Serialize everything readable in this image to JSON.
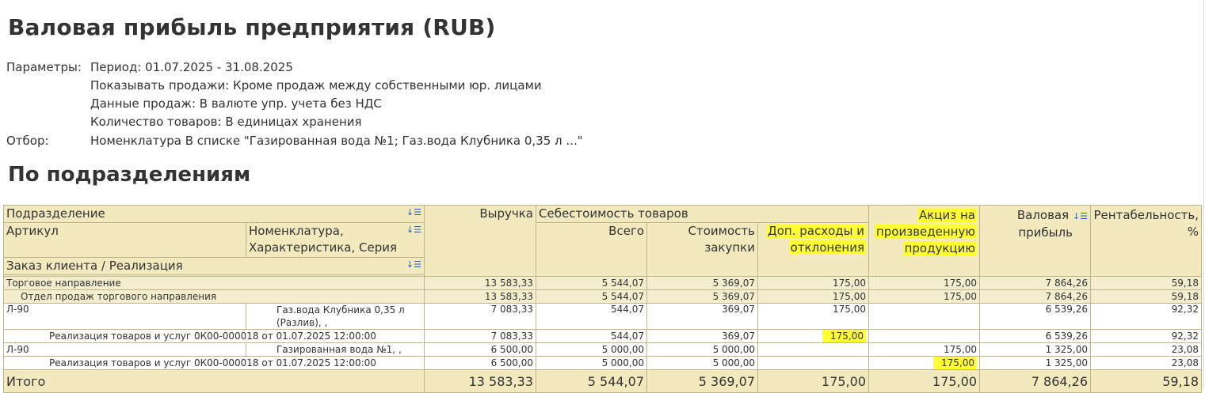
{
  "report": {
    "title": "Валовая прибыль предприятия (RUB)",
    "parameters_label": "Параметры:",
    "filter_label": "Отбор:",
    "parameters": [
      "Период: 01.07.2025 - 31.08.2025",
      "Показывать продажи: Кроме продаж между собственными юр. лицами",
      "Данные продаж: В валюте упр. учета без НДС",
      "Количество товаров: В единицах хранения"
    ],
    "filter": "Номенклатура В списке \"Газированная вода №1; Газ.вода Клубника 0,35 л ...\"",
    "section_title": "По подразделениям"
  },
  "table": {
    "headers": {
      "division": "Подразделение",
      "article": "Артикул",
      "nomenclature_line1": "Номенклатура,",
      "nomenclature_line2": "Характеристика, Серия",
      "order": "Заказ клиента / Реализация",
      "revenue": "Выручка",
      "cost_group": "Себестоимость товаров",
      "total": "Всего",
      "purchase_line1": "Стоимость",
      "purchase_line2": "закупки",
      "extra_line1": "Доп. расходы и",
      "extra_line2": "отклонения",
      "excise_line1": "Акциз на",
      "excise_line2": "произведенную",
      "excise_line3": "продукцию",
      "gross_line1": "Валовая",
      "gross_line2": "прибыль",
      "profit_line1": "Рентабельность,",
      "profit_line2": "%"
    },
    "rows": [
      {
        "label": "Торговое направление",
        "revenue": "13 583,33",
        "total": "5 544,07",
        "purchase": "5 369,07",
        "extra": "175,00",
        "excise": "175,00",
        "gross": "7 864,26",
        "profit": "59,18"
      },
      {
        "label": "Отдел продаж торгового направления",
        "revenue": "13 583,33",
        "total": "5 544,07",
        "purchase": "5 369,07",
        "extra": "175,00",
        "excise": "175,00",
        "gross": "7 864,26",
        "profit": "59,18"
      },
      {
        "article": "Л-90",
        "nom_line1": "Газ.вода Клубника 0,35 л",
        "nom_line2": "(Разлив), ,",
        "revenue": "7 083,33",
        "total": "544,07",
        "purchase": "369,07",
        "extra": "175,00",
        "excise": "",
        "gross": "6 539,26",
        "profit": "92,32"
      },
      {
        "label": "Реализация товаров и услуг 0К00-000018 от 01.07.2025 12:00:00",
        "revenue": "7 083,33",
        "total": "544,07",
        "purchase": "369,07",
        "extra": "175,00",
        "excise": "",
        "gross": "6 539,26",
        "profit": "92,32"
      },
      {
        "article": "Л-90",
        "nom_line1": "Газированная вода №1, ,",
        "revenue": "6 500,00",
        "total": "5 000,00",
        "purchase": "5 000,00",
        "extra": "",
        "excise": "175,00",
        "gross": "1 325,00",
        "profit": "23,08"
      },
      {
        "label": "Реализация товаров и услуг 0К00-000018 от 01.07.2025 12:00:00",
        "revenue": "6 500,00",
        "total": "5 000,00",
        "purchase": "5 000,00",
        "extra": "",
        "excise": "175,00",
        "gross": "1 325,00",
        "profit": "23,08"
      }
    ],
    "totals": {
      "label": "Итого",
      "revenue": "13 583,33",
      "total": "5 544,07",
      "purchase": "5 369,07",
      "extra": "175,00",
      "excise": "175,00",
      "gross": "7 864,26",
      "profit": "59,18"
    },
    "highlight_color": "#ffff33",
    "header_bg": "#f2e9bf",
    "group_bg": "#f5eece"
  }
}
